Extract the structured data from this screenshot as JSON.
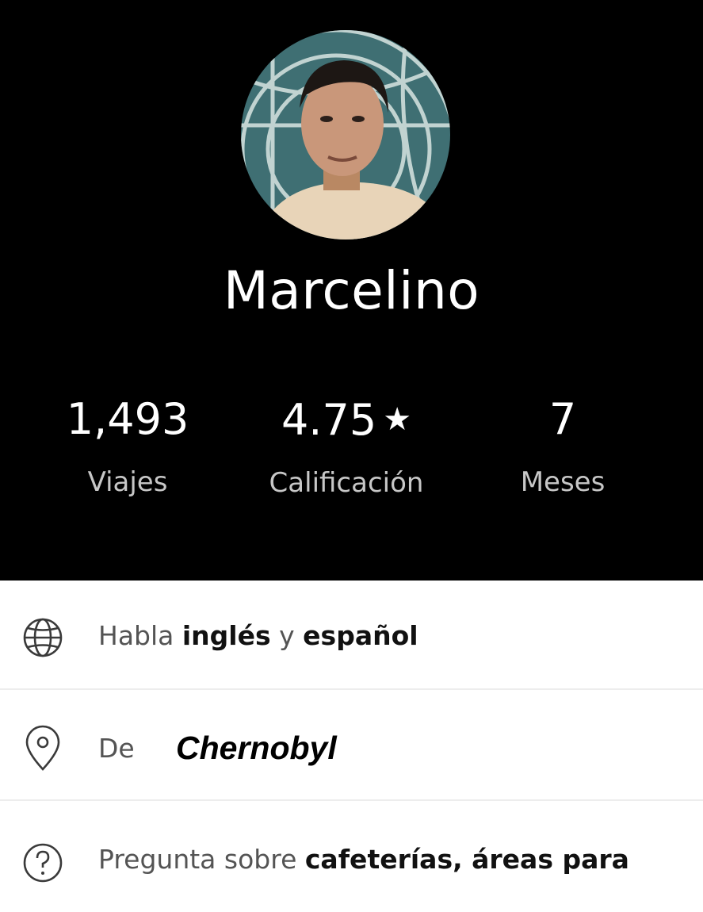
{
  "profile": {
    "name": "Marcelino",
    "avatar_icon": "driver-photo"
  },
  "stats": {
    "trips": {
      "value": "1,493",
      "label": "Viajes"
    },
    "rating": {
      "value": "4.75",
      "star": "★",
      "label": "Calificación"
    },
    "months": {
      "value": "7",
      "label": "Meses"
    }
  },
  "info": {
    "languages": {
      "icon": "globe-icon",
      "prefix": "Habla",
      "lang1": "inglés",
      "connector": "y",
      "lang2": "español"
    },
    "origin": {
      "icon": "location-pin-icon",
      "prefix": "De",
      "place": "Chernobyl"
    },
    "ask_about": {
      "icon": "question-icon",
      "prefix": "Pregunta sobre",
      "topics": "cafeterías, áreas para"
    }
  },
  "colors": {
    "header_bg": "#000000",
    "page_bg": "#ffffff",
    "muted_label": "#c7c7c7",
    "row_text": "#545454",
    "divider": "#ededed"
  }
}
